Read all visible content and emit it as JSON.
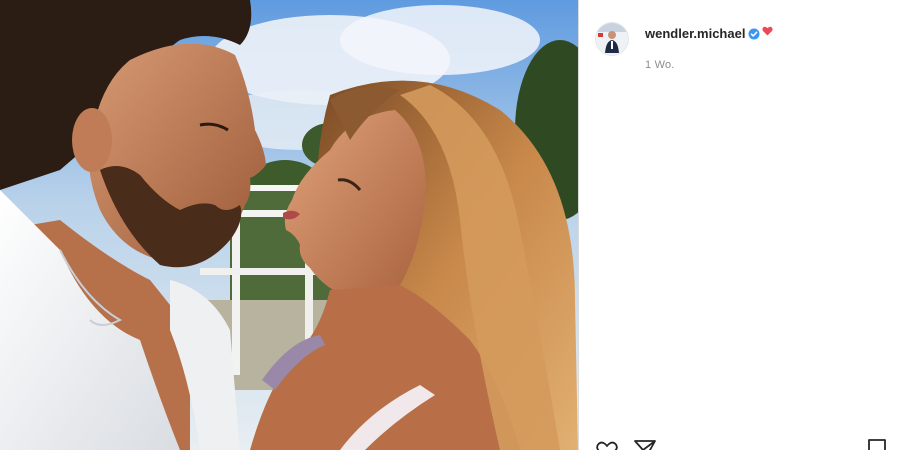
{
  "post": {
    "photo_icon": "couple-photo",
    "author": {
      "username": "wendler.michael",
      "avatar_icon": "profile-avatar",
      "verified_icon": "verified-badge-icon",
      "emoji_icon": "red-heart-emoji"
    },
    "time_ago": "1 Wo."
  },
  "actions": {
    "like_icon": "heart-outline-icon",
    "share_icon": "paper-plane-icon",
    "save_icon": "bookmark-icon"
  },
  "colors": {
    "verified": "#3897f0",
    "heart": "#ed4956",
    "text": "#262626",
    "muted": "#8e8e8e",
    "border": "#dbdbdb"
  }
}
